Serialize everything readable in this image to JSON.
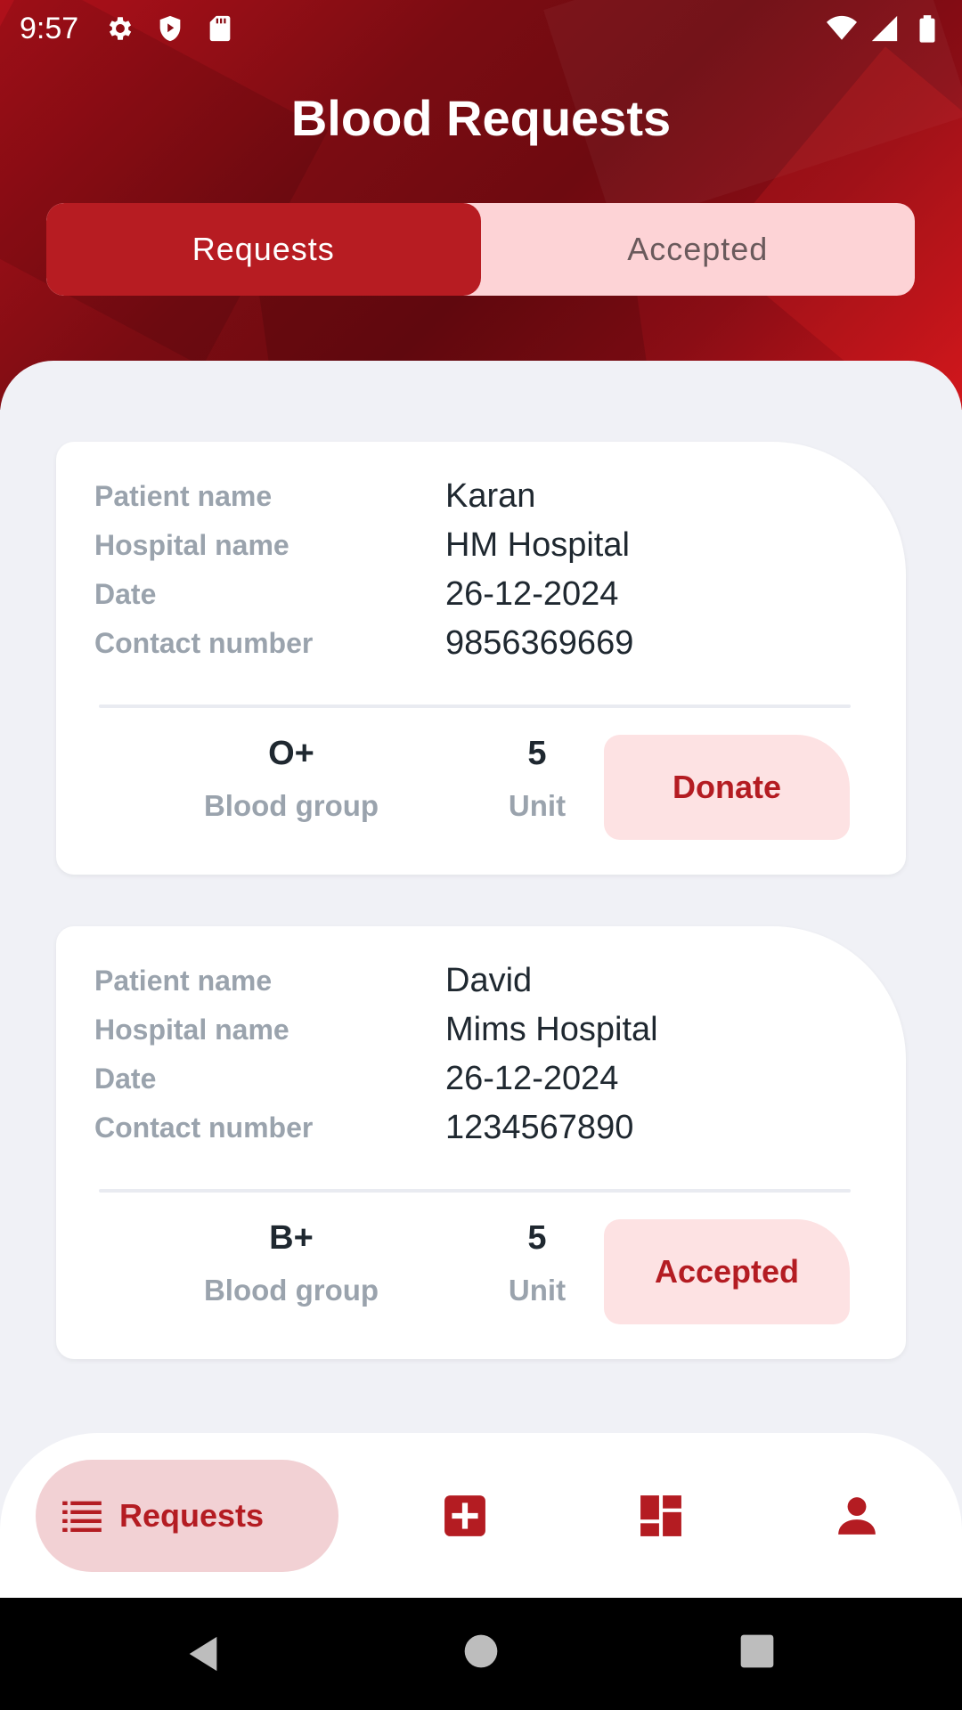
{
  "status_bar": {
    "time": "9:57",
    "left_icons": [
      "gear-icon",
      "shield-icon",
      "sd-card-icon"
    ],
    "right_icons": [
      "wifi-icon",
      "signal-icon",
      "battery-icon"
    ]
  },
  "header": {
    "title": "Blood Requests"
  },
  "tabs": [
    {
      "label": "Requests",
      "active": true
    },
    {
      "label": "Accepted",
      "active": false
    }
  ],
  "cards": [
    {
      "rows": [
        {
          "label": "Patient name",
          "value": "Karan"
        },
        {
          "label": "Hospital name",
          "value": "HM Hospital"
        },
        {
          "label": "Date",
          "value": "26-12-2024"
        },
        {
          "label": "Contact number",
          "value": "9856369669"
        }
      ],
      "blood_group": "O+",
      "blood_group_label": "Blood group",
      "unit": "5",
      "unit_label": "Unit",
      "action": "Donate"
    },
    {
      "rows": [
        {
          "label": "Patient name",
          "value": "David"
        },
        {
          "label": "Hospital name",
          "value": "Mims Hospital"
        },
        {
          "label": "Date",
          "value": "26-12-2024"
        },
        {
          "label": "Contact number",
          "value": "1234567890"
        }
      ],
      "blood_group": "B+",
      "blood_group_label": "Blood group",
      "unit": "5",
      "unit_label": "Unit",
      "action": "Accepted"
    }
  ],
  "bottom_nav": {
    "active_label": "Requests",
    "items": [
      "list-icon",
      "add-square-icon",
      "dashboard-icon",
      "person-icon"
    ]
  },
  "colors": {
    "accent": "#b41c22",
    "accent_light": "#fde2e3",
    "label_grey": "#9aa3ad",
    "text_dark": "#1f2830"
  }
}
